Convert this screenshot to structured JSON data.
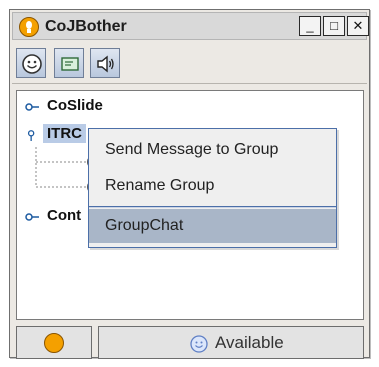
{
  "window": {
    "title": "CoJBother",
    "controls": {
      "minimize": "_",
      "maximize": "□",
      "close": "✕"
    }
  },
  "toolbar": {
    "buttons": [
      {
        "icon": "smiley-icon"
      },
      {
        "icon": "chat-window-icon"
      },
      {
        "icon": "speaker-icon"
      }
    ]
  },
  "tree": {
    "groups": [
      {
        "label": "CoSlide"
      },
      {
        "label": "ITRC",
        "selected": true
      },
      {
        "label": "Cont"
      }
    ]
  },
  "context_menu": {
    "items": [
      {
        "label": "Send Message to Group"
      },
      {
        "label": "Rename Group"
      },
      {
        "label": "GroupChat",
        "highlighted": true
      }
    ]
  },
  "status": {
    "icon": "lightbulb-icon",
    "presence_icon": "smiley-icon",
    "presence_text": "Available"
  },
  "colors": {
    "selection": "#b9cbe6",
    "menu_highlight": "#a9b6c8",
    "menu_border": "#4c6fa8"
  }
}
